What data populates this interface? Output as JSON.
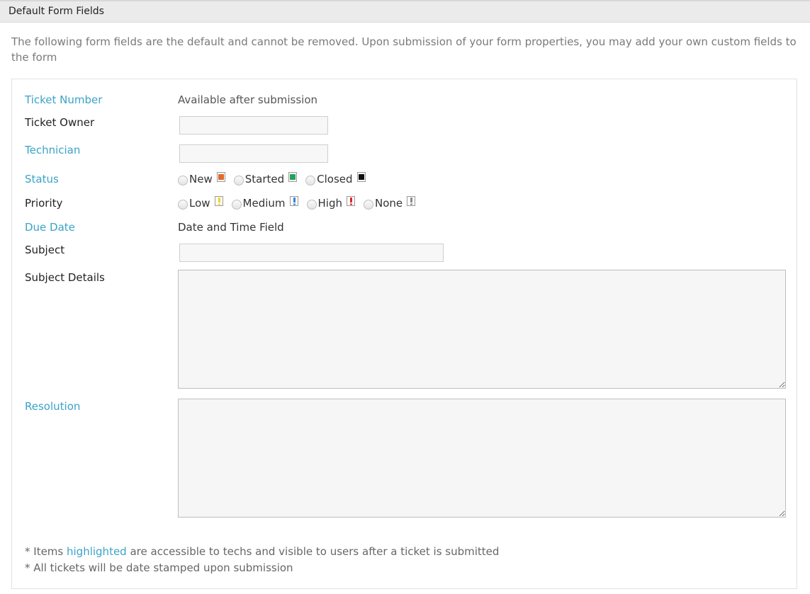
{
  "panel": {
    "title": "Default Form Fields"
  },
  "intro": "The following form fields are the default and cannot be removed. Upon submission of your form properties, you may add your own custom fields to the form",
  "fields": {
    "ticket_number": {
      "label": "Ticket Number",
      "value": "Available after submission"
    },
    "ticket_owner": {
      "label": "Ticket Owner",
      "value": ""
    },
    "technician": {
      "label": "Technician",
      "value": ""
    },
    "status": {
      "label": "Status",
      "options": [
        {
          "label": "New",
          "icon": "orange-flag-icon",
          "color": "#e06b2c"
        },
        {
          "label": "Started",
          "icon": "green-flag-icon",
          "color": "#23a35a"
        },
        {
          "label": "Closed",
          "icon": "black-flag-icon",
          "color": "#111111"
        }
      ]
    },
    "priority": {
      "label": "Priority",
      "options": [
        {
          "label": "Low",
          "icon": "yellow-exclamation-icon",
          "color": "#f2d21b"
        },
        {
          "label": "Medium",
          "icon": "blue-exclamation-icon",
          "color": "#2f86d6"
        },
        {
          "label": "High",
          "icon": "red-exclamation-icon",
          "color": "#e02424"
        },
        {
          "label": "None",
          "icon": "gray-exclamation-icon",
          "color": "#8a8a8a"
        }
      ]
    },
    "due_date": {
      "label": "Due Date",
      "value": "Date and Time Field"
    },
    "subject": {
      "label": "Subject",
      "value": ""
    },
    "subject_details": {
      "label": "Subject Details",
      "value": ""
    },
    "resolution": {
      "label": "Resolution",
      "value": ""
    }
  },
  "footer": {
    "note1_prefix": "* Items ",
    "note1_highlight": "highlighted",
    "note1_suffix": " are accessible to techs and visible to users after a ticket is submitted",
    "note2": "* All tickets will be date stamped upon submission"
  },
  "colors": {
    "highlight": "#3aa3c8",
    "header_bg": "#ebebeb"
  }
}
